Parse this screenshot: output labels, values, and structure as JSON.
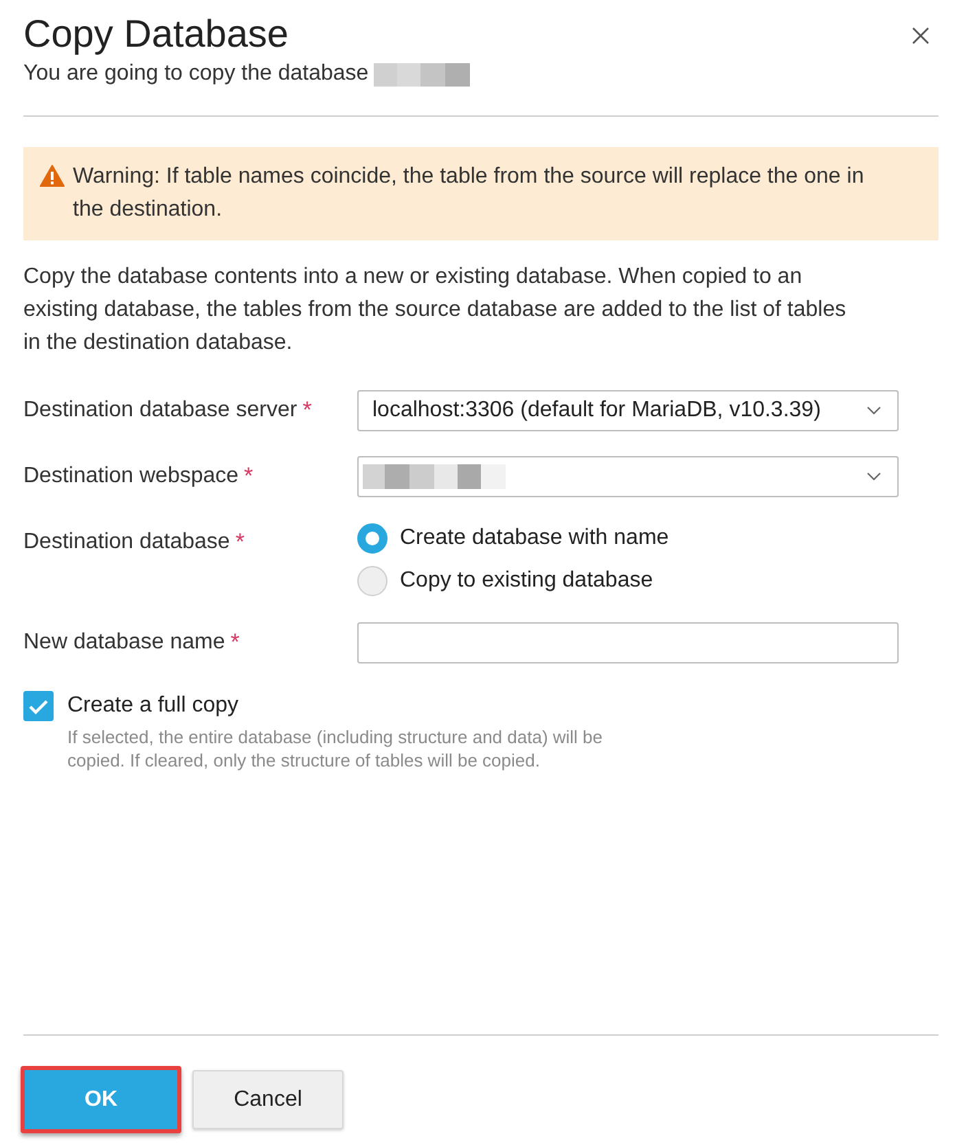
{
  "dialog": {
    "title": "Copy Database",
    "subtitle": "You are going to copy the database",
    "name_redacted": true
  },
  "warning": {
    "text": "Warning: If table names coincide, the table from the source will replace the one in the destination."
  },
  "description": "Copy the database contents into a new or existing database. When copied to an existing database, the tables from the source database are added to the list of tables in the destination database.",
  "fields": [
    {
      "kind": "select",
      "label": "Destination database server",
      "required_mark": "*",
      "value": "localhost:3306 (default for MariaDB, v10.3.39)"
    },
    {
      "kind": "select",
      "label": "Destination webspace",
      "required_mark": "*",
      "value_redacted": true
    },
    {
      "kind": "radio",
      "label": "Destination database",
      "required_mark": "*",
      "options": [
        {
          "label": "Create database with name",
          "selected": true
        },
        {
          "label": "Copy to existing database",
          "selected": false
        }
      ]
    },
    {
      "kind": "text",
      "label": "New database name",
      "required_mark": "*"
    }
  ],
  "checkbox": {
    "label": "Create a full copy",
    "checked": true,
    "hint": "If selected, the entire database (including structure and data) will be copied. If cleared, only the structure of tables will be copied."
  },
  "buttons": [
    {
      "label": "OK",
      "kind": "primary",
      "highlighted": true
    },
    {
      "label": "Cancel",
      "kind": "secondary",
      "highlighted": false
    }
  ]
}
